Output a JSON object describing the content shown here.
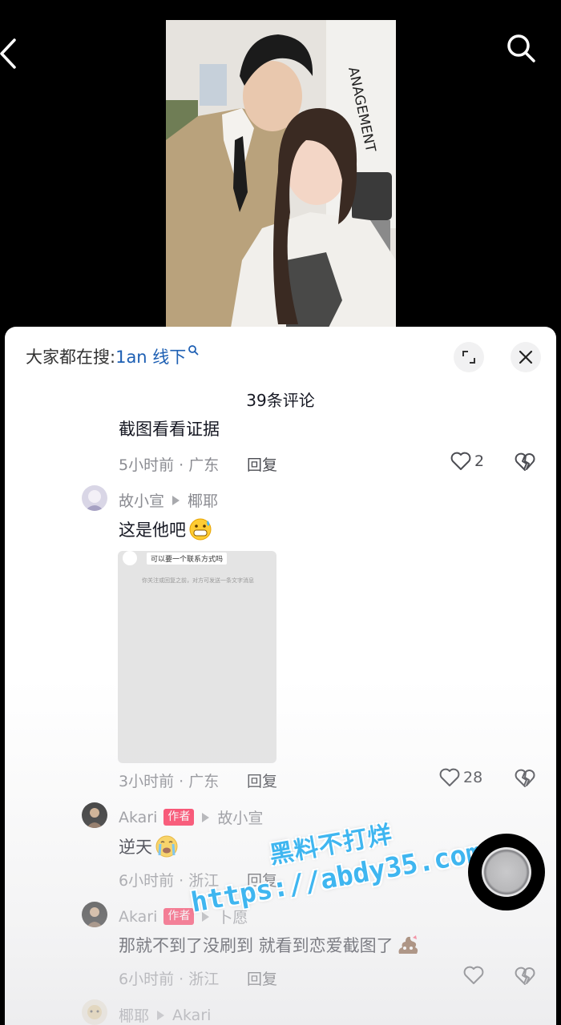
{
  "header": {
    "back_icon": "chevron-left-icon",
    "search_icon": "search-icon"
  },
  "video": {
    "wall_text": "ANAGEMENT"
  },
  "panel": {
    "search_hint_prefix": "大家都在搜:",
    "search_hint_keyword": "1an 线下",
    "comment_count": "39条评论",
    "colors": {
      "keyword": "#1d5fb3",
      "author_tag": "#fe2c55",
      "watermark": "#3fb6f0"
    }
  },
  "comments": [
    {
      "text": "截图看看证据",
      "time": "5小时前 · 广东",
      "reply": "回复",
      "likes": "2"
    },
    {
      "user": "故小宣",
      "reply_to": "椰耶",
      "text": "这是他吧",
      "emoji": "grimace-emoji",
      "screenshot_title": "可以要一个联系方式吗",
      "screenshot_sub": "你关注或回复之前，对方可发送一条文字消息",
      "time": "3小时前 · 广东",
      "reply": "回复",
      "likes": "28"
    },
    {
      "user": "Akari",
      "tag": "作者",
      "reply_to": "故小宣",
      "text": "逆天",
      "emoji": "crying-emoji",
      "time": "6小时前 · 浙江",
      "reply": "回复"
    },
    {
      "user": "Akari",
      "tag": "作者",
      "reply_to": "卜愿",
      "text": "那就不到了没刷到 就看到恋爱截图了",
      "emoji": "poop-emoji",
      "time": "6小时前 · 浙江",
      "reply": "回复"
    },
    {
      "user": "椰耶",
      "reply_to": "Akari"
    }
  ],
  "watermark": {
    "line1": "黑料不打烊",
    "line2": "https://abdy35.com"
  }
}
